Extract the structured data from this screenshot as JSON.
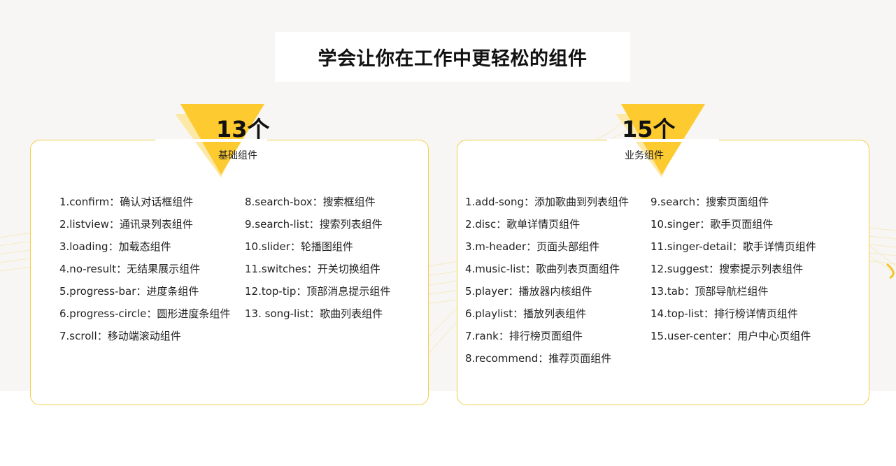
{
  "title": "学会让你在工作中更轻松的组件",
  "colors": {
    "accent": "#fdca2f",
    "accent_light": "#fde9a7",
    "card_border": "#f3cf4c",
    "background": "#f7f6f4"
  },
  "basic": {
    "count": "13个",
    "label": "基础组件",
    "col1": [
      "1.confirm：确认对话框组件",
      "2.listview：通讯录列表组件",
      "3.loading：加载态组件",
      "4.no-result：无结果展示组件",
      "5.progress-bar：进度条组件",
      "6.progress-circle：圆形进度条组件",
      "7.scroll：移动端滚动组件"
    ],
    "col2": [
      "8.search-box：搜索框组件",
      "9.search-list：搜索列表组件",
      "10.slider：轮播图组件",
      "11.switches：开关切换组件",
      "12.top-tip：顶部消息提示组件",
      "13. song-list：歌曲列表组件"
    ]
  },
  "business": {
    "count": "15个",
    "label": "业务组件",
    "col1": [
      "1.add-song：添加歌曲到列表组件",
      "2.disc：歌单详情页组件",
      "3.m-header：页面头部组件",
      "4.music-list：歌曲列表页面组件",
      "5.player：播放器内核组件",
      "6.playlist：播放列表组件",
      "7.rank：排行榜页面组件",
      "8.recommend：推荐页面组件"
    ],
    "col2": [
      "9.search：搜索页面组件",
      "10.singer：歌手页面组件",
      "11.singer-detail：歌手详情页组件",
      "12.suggest：搜索提示列表组件",
      "13.tab：顶部导航栏组件",
      "14.top-list：排行榜详情页组件",
      "15.user-center：用户中心页组件"
    ]
  }
}
